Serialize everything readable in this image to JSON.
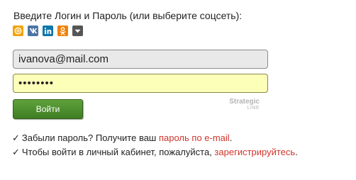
{
  "login": {
    "prompt": "Введите Логин и Пароль (или выберите соцсеть):",
    "social": [
      {
        "name": "mail-ru",
        "icon": "mail-ru-icon",
        "color": "#f0a30a"
      },
      {
        "name": "vkontakte",
        "icon": "vk-icon",
        "color": "#4c75a3"
      },
      {
        "name": "linkedin",
        "icon": "linkedin-icon",
        "color": "#0e76a8"
      },
      {
        "name": "odnoklassniki",
        "icon": "odnoklassniki-icon",
        "color": "#ee8208"
      },
      {
        "name": "more",
        "icon": "chevron-down-icon",
        "color": "#555555"
      }
    ],
    "email_value": "ivanova@mail.com",
    "password_value": "........",
    "submit_label": "Войти",
    "brand_top": "Strategic",
    "brand_bottom": "LINE"
  },
  "hints": {
    "check": "✓",
    "forgot_text": "Забыли пароль? Получите ваш",
    "forgot_link": "пароль по e-mail",
    "forgot_end": ".",
    "register_text": "Чтобы войти в личный кабинет, пожалуйста,",
    "register_link": "зарегистрируйтесь",
    "register_end": "."
  },
  "colors": {
    "accent_green": "#4c8f2c",
    "link_red": "#d0342c",
    "password_bg": "#fbffb8",
    "email_bg": "#e9e9e9"
  }
}
